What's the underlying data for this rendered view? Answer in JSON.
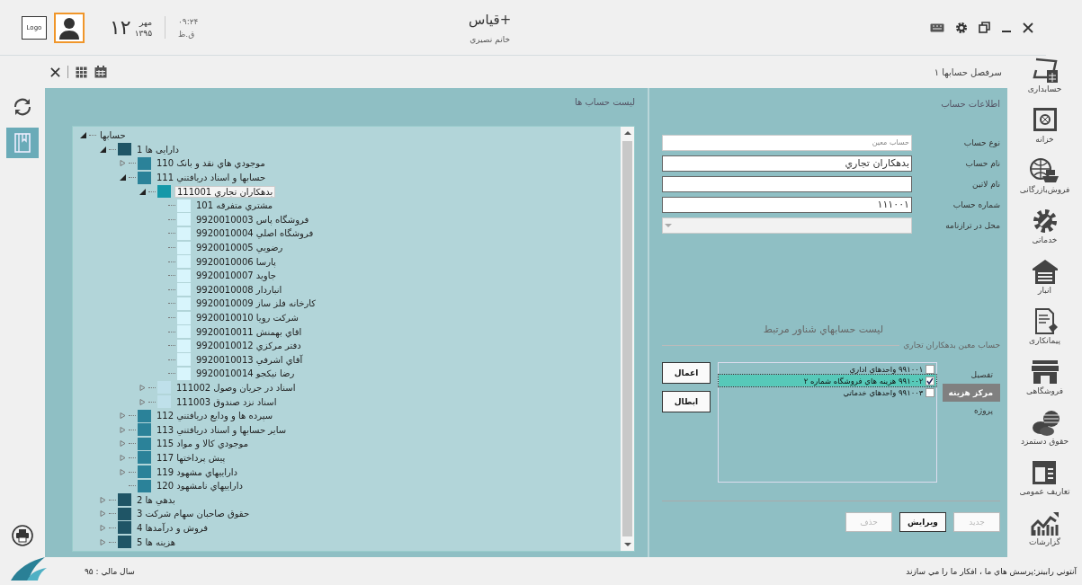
{
  "header": {
    "app_title": "قیاس+",
    "user_name": "خانم نصيري",
    "day": "۱۲",
    "month": "مهر",
    "year": "۱۳۹۵",
    "time": "۰۹:۲۴",
    "period": "ق.ظ",
    "logo": "Logo"
  },
  "breadcrumb": "سرفصل حسابها ۱",
  "left_tools": [
    {
      "kind": "refresh",
      "selected": false
    },
    {
      "kind": "book",
      "selected": true
    }
  ],
  "nav": [
    {
      "kind": "calculator",
      "label": "حسابداری"
    },
    {
      "kind": "safe",
      "label": "خزانه"
    },
    {
      "kind": "globe",
      "label": "فروش‌بازرگانی"
    },
    {
      "kind": "gear",
      "label": "خدماتی"
    },
    {
      "kind": "warehouse",
      "label": "انبار"
    },
    {
      "kind": "document",
      "label": "پیمانکاری"
    },
    {
      "kind": "store",
      "label": "فروشگاهی"
    },
    {
      "kind": "coins",
      "label": "حقوق دستمزد"
    },
    {
      "kind": "layout",
      "label": "تعاریف عمومی"
    },
    {
      "kind": "chart",
      "label": "گزارشات"
    }
  ],
  "accounts_panel": {
    "title": "لیست حساب ها",
    "tree": {
      "name": "حسابها",
      "expanded": true,
      "selected": false,
      "children": [
        {
          "code": "1",
          "name": "دارایی ها",
          "expanded": true,
          "selected": false,
          "children": [
            {
              "code": "110",
              "name": "موجودي هاي نقد و بانک",
              "expanded": false,
              "selected": false
            },
            {
              "code": "111",
              "name": "حسابها و اسناد دريافتني",
              "expanded": true,
              "selected": false,
              "children": [
                {
                  "code": "111001",
                  "name": "بدهكاران تجاري",
                  "expanded": true,
                  "selected": true,
                  "children": [
                    {
                      "code": "101",
                      "name": "مشتري متفرقه",
                      "selected": false
                    },
                    {
                      "code": "9920010003",
                      "name": "فروشگاه پاس",
                      "selected": false
                    },
                    {
                      "code": "9920010004",
                      "name": "فروشگاه اصلي",
                      "selected": false
                    },
                    {
                      "code": "9920010005",
                      "name": "رضويي",
                      "selected": false
                    },
                    {
                      "code": "9920010006",
                      "name": "پارسا",
                      "selected": false
                    },
                    {
                      "code": "9920010007",
                      "name": "جاويد",
                      "selected": false
                    },
                    {
                      "code": "9920010008",
                      "name": "انباردار",
                      "selected": false
                    },
                    {
                      "code": "9920010009",
                      "name": "كارخانه فلز ساز",
                      "selected": false
                    },
                    {
                      "code": "9920010010",
                      "name": "شركت رويا",
                      "selected": false
                    },
                    {
                      "code": "9920010011",
                      "name": "اقاي بهمنش",
                      "selected": false
                    },
                    {
                      "code": "9920010012",
                      "name": "دفتر مركزي",
                      "selected": false
                    },
                    {
                      "code": "9920010013",
                      "name": "آقاي اشرفي",
                      "selected": false
                    },
                    {
                      "code": "9920010014",
                      "name": "رضا نيكجو",
                      "selected": false
                    }
                  ]
                },
                {
                  "code": "111002",
                  "name": "اسناد در جريان وصول",
                  "expanded": false,
                  "selected": false
                },
                {
                  "code": "111003",
                  "name": "اسناد نزد صندوق",
                  "expanded": false,
                  "selected": false
                }
              ]
            },
            {
              "code": "112",
              "name": "سپرده ها  و ودايع دريافتني",
              "expanded": false,
              "selected": false
            },
            {
              "code": "113",
              "name": "ساير حسابها و اسناد دريافتني",
              "expanded": false,
              "selected": false
            },
            {
              "code": "115",
              "name": "موجودي كالا و مواد",
              "expanded": false,
              "selected": false
            },
            {
              "code": "117",
              "name": "پيش پرداختها",
              "expanded": false,
              "selected": false
            },
            {
              "code": "119",
              "name": "داراييهاي مشهود",
              "expanded": false,
              "selected": false
            },
            {
              "code": "120",
              "name": "داراييهاي نامشهود",
              "selected": false
            }
          ]
        },
        {
          "code": "2",
          "name": "بدهي ها",
          "expanded": false,
          "selected": false
        },
        {
          "code": "3",
          "name": "حقوق صاحبان سهام شركت",
          "expanded": false,
          "selected": false
        },
        {
          "code": "4",
          "name": "فروش و درآمدها",
          "expanded": false,
          "selected": false
        },
        {
          "code": "5",
          "name": "هزينه ها",
          "expanded": false,
          "selected": false
        }
      ]
    }
  },
  "info_panel": {
    "title": "اطلاعات حساب",
    "fields": [
      {
        "kind": "text",
        "label": "نوع حساب",
        "value": "حساب معين",
        "disabled": true
      },
      {
        "kind": "text",
        "label": "نام حساب",
        "value": "بدهكاران تجاري",
        "disabled": false
      },
      {
        "kind": "text",
        "label": "نام لاتين",
        "disabled": false
      },
      {
        "kind": "text",
        "label": "شماره حساب",
        "value": "۱۱۱۰۰۱",
        "disabled": false
      },
      {
        "kind": "select",
        "label": "محل در ترازنامه",
        "disabled": true
      }
    ],
    "floating_title": "لیست حسابهاي شناور مرتبط",
    "floating_subtitle": "حساب معين بدهكاران تجاري",
    "categories": [
      {
        "label": "تفصيل",
        "selected": false
      },
      {
        "label": "مركز هزينه",
        "selected": true
      },
      {
        "label": "پروژه",
        "selected": false
      }
    ],
    "items": [
      {
        "label": "۹۹۱۰۰۱ واحدهاي اداري",
        "checked": false,
        "selected": false
      },
      {
        "label": "۹۹۱۰۰۲ هزينه هاي  فروشگاه شماره ۲",
        "checked": true,
        "selected": true
      },
      {
        "label": "۹۹۱۰۰۳ واحدهاي خدماتي",
        "checked": false,
        "selected": false
      }
    ],
    "side_buttons": [
      {
        "label": "اعمال",
        "disabled": false
      },
      {
        "label": "ابطال",
        "disabled": false
      }
    ],
    "bottom_buttons": [
      {
        "label": "جديد",
        "disabled": true
      },
      {
        "label": "ويرايش",
        "disabled": false
      },
      {
        "label": "حذف",
        "disabled": true
      }
    ]
  },
  "status_bar": {
    "fiscal_year": "سال مالي : ۹۵",
    "quote": "آنتوني رابينز:پرسش هاي ما ، افكار ما را مي سازند"
  }
}
